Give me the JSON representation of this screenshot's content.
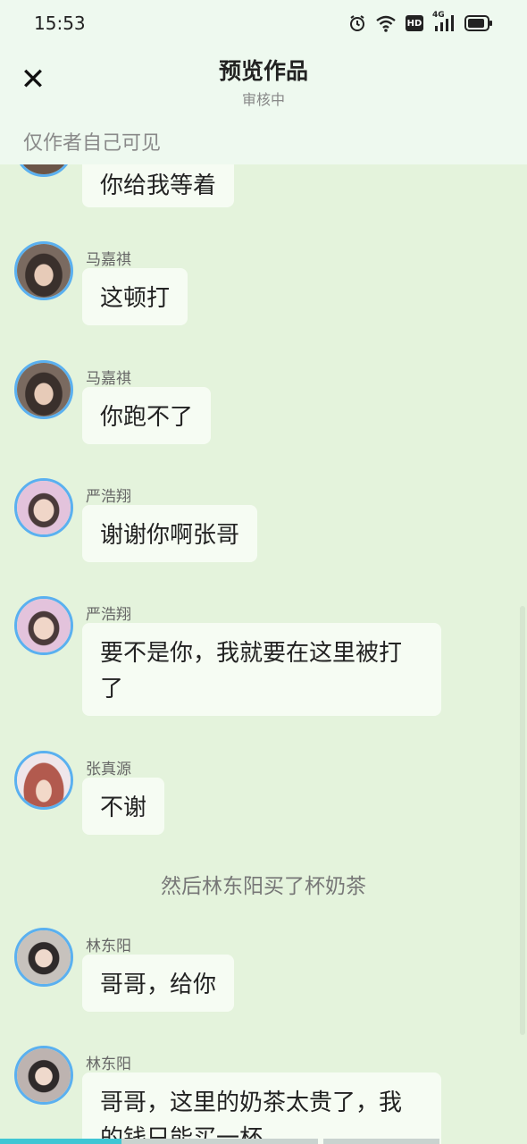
{
  "status_bar": {
    "time": "15:53",
    "icons": [
      "alarm-icon",
      "wifi-icon",
      "hd-icon",
      "4g-signal-icon",
      "battery-icon"
    ],
    "hd_label": "HD",
    "net_label": "4G"
  },
  "header": {
    "close_glyph": "✕",
    "title": "预览作品",
    "subtitle": "审核中",
    "visibility": "仅作者自己可见"
  },
  "messages": [
    {
      "sender": "",
      "text": "你给我等着",
      "avatar_color": "#6b5548"
    },
    {
      "sender": "马嘉祺",
      "text": "这顿打",
      "avatar_color": "#5b4a42"
    },
    {
      "sender": "马嘉祺",
      "text": "你跑不了",
      "avatar_color": "#5b4a42"
    },
    {
      "sender": "严浩翔",
      "text": "谢谢你啊张哥",
      "avatar_color": "#d7b8d0"
    },
    {
      "sender": "严浩翔",
      "text": "要不是你，我就要在这里被打了",
      "avatar_color": "#d7b8d0"
    },
    {
      "sender": "张真源",
      "text": "不谢",
      "avatar_color": "#b25a4e"
    },
    {
      "sender": "林东阳",
      "text": "哥哥，给你",
      "avatar_color": "#c7c2bd"
    },
    {
      "sender": "林东阳",
      "text": "哥哥，这里的奶茶太贵了，我的钱只能买一杯",
      "avatar_color": "#bdb3b0"
    }
  ],
  "narration": "然后林东阳买了杯奶茶",
  "colors": {
    "header_bg": "#eef9ef",
    "chat_bg": "#e4f3dc",
    "bubble_bg": "#f6fcf3",
    "avatar_border": "#5ab0f0"
  }
}
